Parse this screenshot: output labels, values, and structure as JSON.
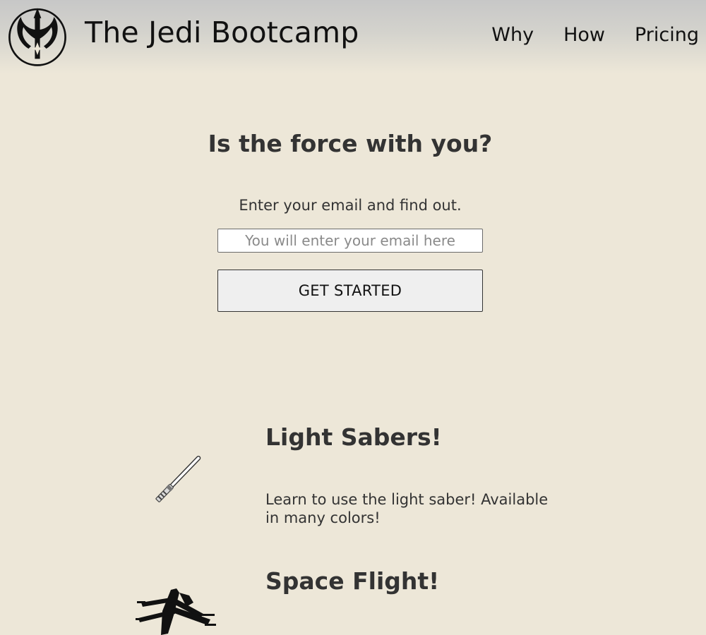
{
  "header": {
    "site_title": "The Jedi Bootcamp",
    "nav": [
      "Why",
      "How",
      "Pricing"
    ],
    "logo_icon": "jedi-order-icon"
  },
  "hero": {
    "title": "Is the force with you?",
    "subtitle": "Enter your email and find out.",
    "email_placeholder": "You will enter your email here",
    "cta_label": "GET STARTED"
  },
  "features": [
    {
      "icon": "lightsaber-icon",
      "title": "Light Sabers!",
      "description": "Learn to use the light saber! Available in many colors!"
    },
    {
      "icon": "x-wing-icon",
      "title": "Space Flight!",
      "description": ""
    }
  ],
  "colors": {
    "background": "#ede7d8",
    "header_top": "#c7c7c7",
    "text": "#333333",
    "button_bg": "#efefef"
  }
}
